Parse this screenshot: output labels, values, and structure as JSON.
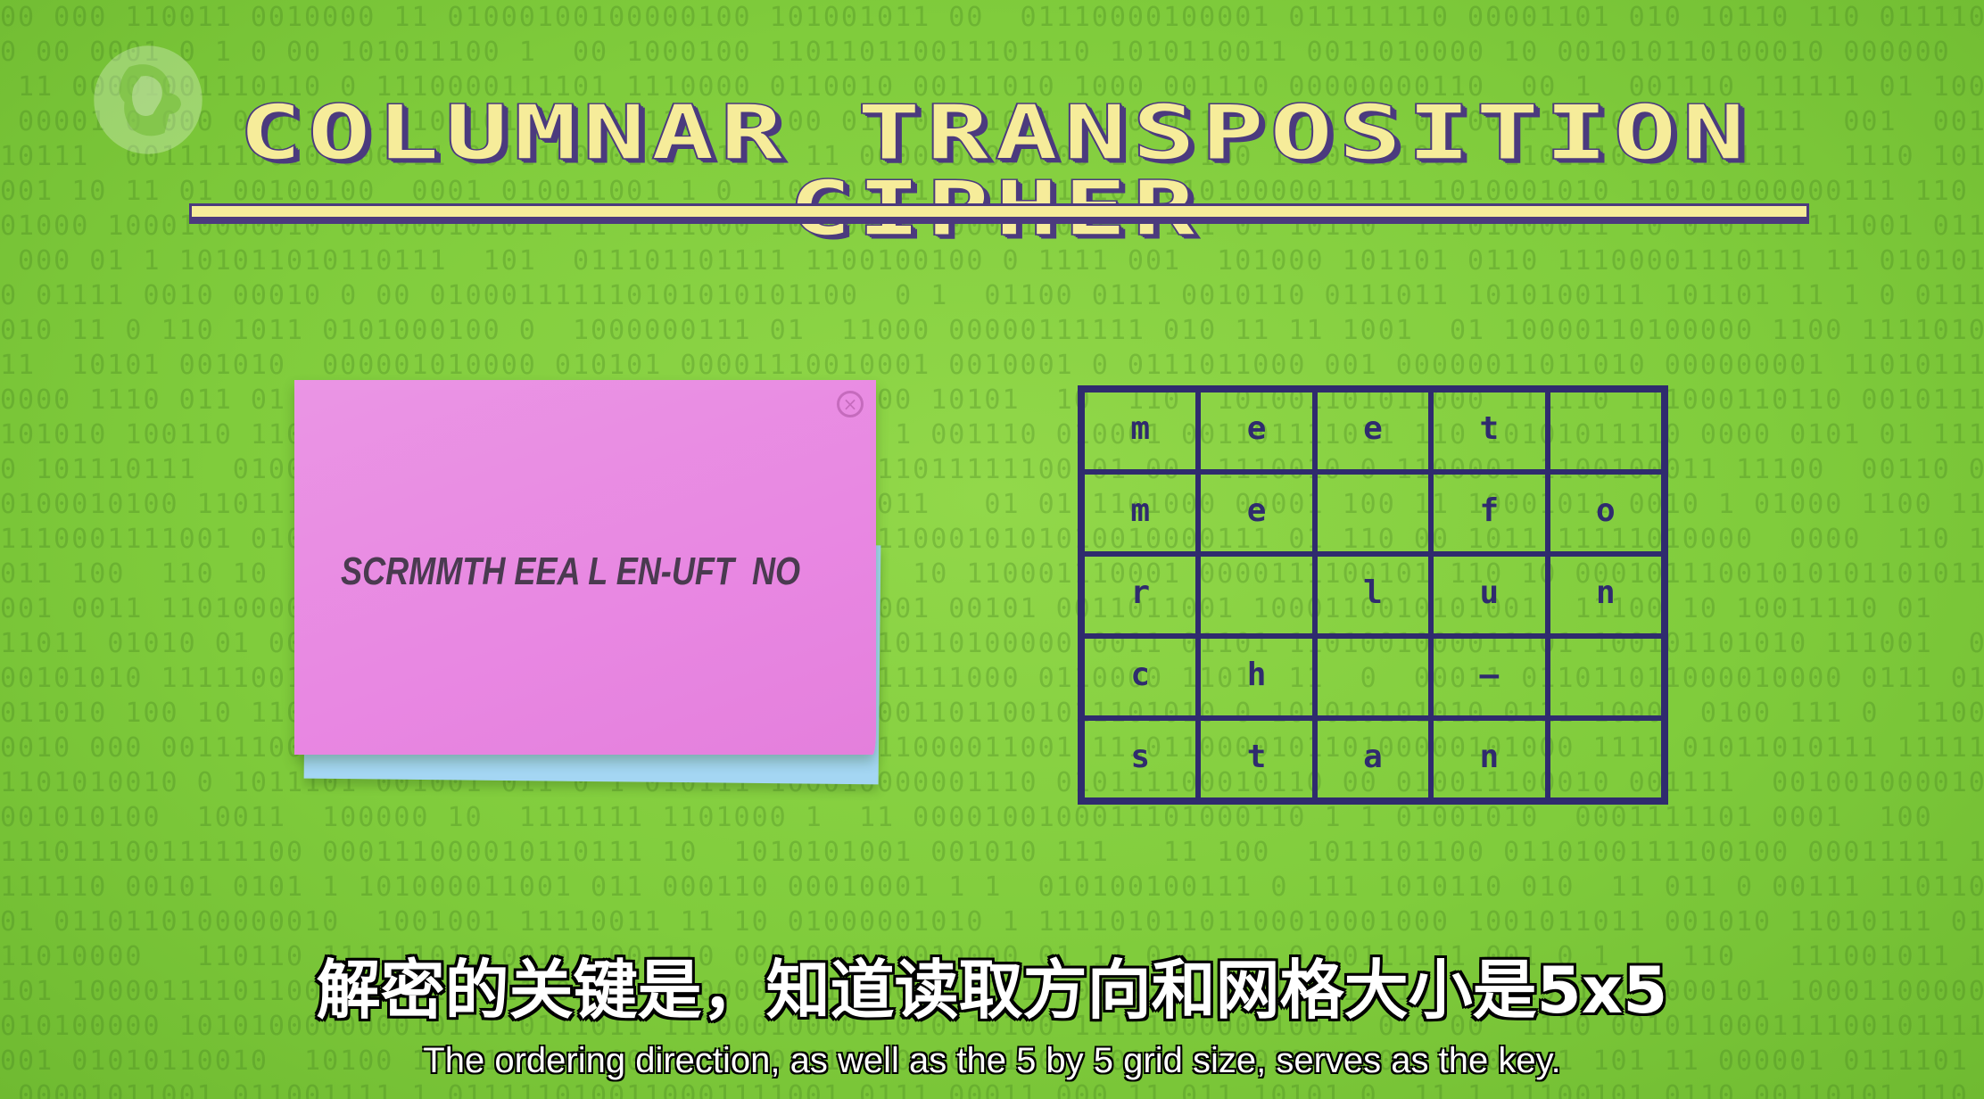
{
  "title": "COLUMNAR TRANSPOSITION CIPHER",
  "logo": {
    "icon": "pbs-logo-icon"
  },
  "note": {
    "ciphertext": "SCRMMTH EEA L EN-UFT  NO",
    "close_icon": "close-circle-icon",
    "color": "#e887e2",
    "under_color": "#a4d6f3"
  },
  "grid": {
    "rows": [
      [
        "m",
        "e",
        "e",
        "t",
        ""
      ],
      [
        "m",
        "e",
        "",
        "f",
        "o"
      ],
      [
        "r",
        "",
        "l",
        "u",
        "n"
      ],
      [
        "c",
        "h",
        "",
        "–",
        ""
      ],
      [
        "s",
        "t",
        "a",
        "n",
        ""
      ]
    ],
    "line_color": "#2f2b6e"
  },
  "subtitles": {
    "zh": "解密的关键是，知道读取方向和网格大小是5x5",
    "en": "The ordering direction, as well as the 5 by 5 grid size, serves as the key."
  },
  "colors": {
    "background": "#80cc3c",
    "title_fill": "#f6ec9a",
    "title_outline": "#4b3a7e"
  }
}
